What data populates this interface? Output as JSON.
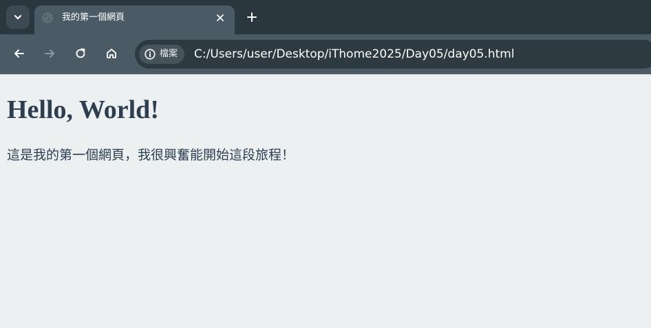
{
  "browser": {
    "tab": {
      "title": "我的第一個網頁"
    },
    "address_bar": {
      "security_chip_label": "檔案",
      "url": "C:/Users/user/Desktop/iThome2025/Day05/day05.html"
    }
  },
  "page": {
    "heading": "Hello, World!",
    "paragraph": "這是我的第一個網頁，我很興奮能開始這段旅程！",
    "background_color": "#ecf0f1",
    "text_color": "#2c3e50"
  },
  "icons": {
    "tab_search": "chevron-down-icon",
    "favicon": "globe-icon",
    "tab_close": "close-icon",
    "new_tab": "plus-icon",
    "back": "arrow-left-icon",
    "forward": "arrow-right-icon",
    "reload": "reload-icon",
    "home": "home-icon",
    "site_info": "info-icon"
  }
}
